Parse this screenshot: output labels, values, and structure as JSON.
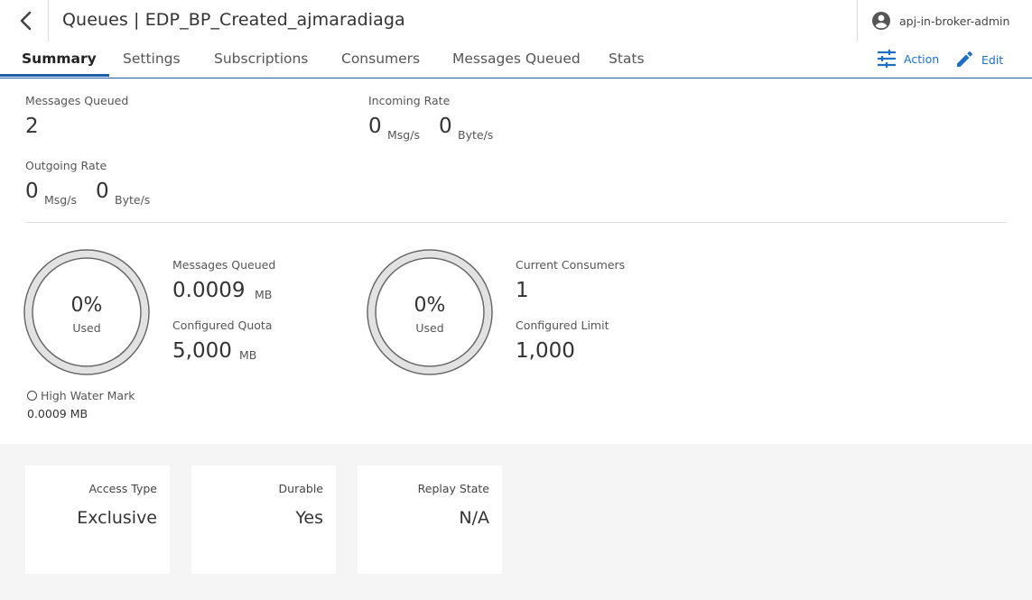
{
  "header": {
    "title": "Queues | EDP_BP_Created_ajmaradiaga",
    "user": "apj-in-broker-admin"
  },
  "tabs": [
    "Summary",
    "Settings",
    "Subscriptions",
    "Consumers",
    "Messages Queued",
    "Stats"
  ],
  "active_tab": "Summary",
  "actions": {
    "action_label": "Action",
    "edit_label": "Edit"
  },
  "accent_color": "#1d6fc4",
  "stats": {
    "messages_queued": {
      "label": "Messages Queued",
      "value": "2"
    },
    "incoming_rate": {
      "label": "Incoming Rate",
      "msg_value": "0",
      "msg_unit": "Msg/s",
      "byte_value": "0",
      "byte_unit": "Byte/s"
    },
    "outgoing_rate": {
      "label": "Outgoing Rate",
      "msg_value": "0",
      "msg_unit": "Msg/s",
      "byte_value": "0",
      "byte_unit": "Byte/s"
    }
  },
  "quota_gauge": {
    "percent": "0%",
    "used_label": "Used",
    "messages_queued_label": "Messages Queued",
    "messages_queued_value": "0.0009",
    "messages_queued_unit": "MB",
    "configured_quota_label": "Configured Quota",
    "configured_quota_value": "5,000",
    "configured_quota_unit": "MB",
    "high_water_mark_label": "High Water Mark",
    "high_water_mark_value": "0.0009 MB"
  },
  "consumer_gauge": {
    "percent": "0%",
    "used_label": "Used",
    "current_consumers_label": "Current Consumers",
    "current_consumers_value": "1",
    "configured_limit_label": "Configured Limit",
    "configured_limit_value": "1,000"
  },
  "cards": [
    {
      "label": "Access Type",
      "value": "Exclusive"
    },
    {
      "label": "Durable",
      "value": "Yes"
    },
    {
      "label": "Replay State",
      "value": "N/A"
    }
  ],
  "icons": {
    "back": "chevron-left-icon",
    "user": "account-circle-icon",
    "action": "sliders-icon",
    "edit": "pencil-icon",
    "high_water_mark": "circle-outline-icon"
  }
}
